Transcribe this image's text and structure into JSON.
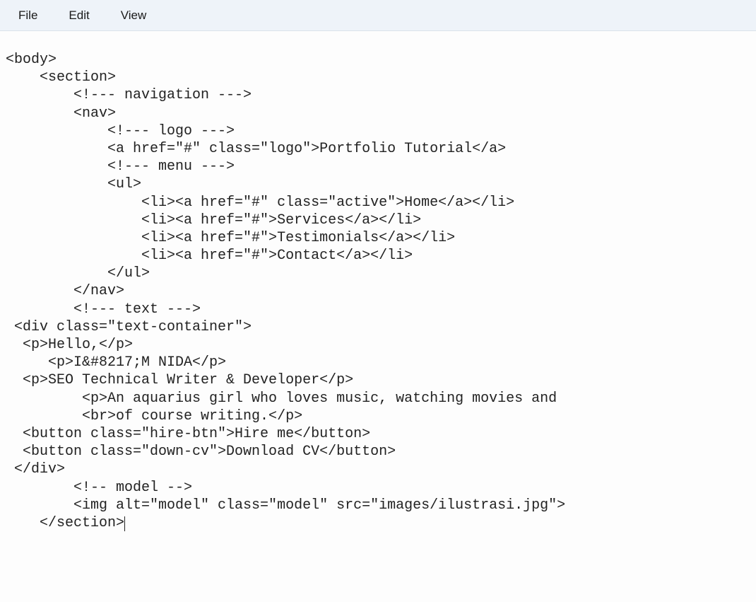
{
  "menubar": {
    "items": [
      "File",
      "Edit",
      "View"
    ]
  },
  "code": {
    "lines": [
      "<body>",
      "    <section>",
      "        <!--- navigation --->",
      "        <nav>",
      "            <!--- logo --->",
      "            <a href=\"#\" class=\"logo\">Portfolio Tutorial</a>",
      "            <!--- menu --->",
      "            <ul>",
      "                <li><a href=\"#\" class=\"active\">Home</a></li>",
      "                <li><a href=\"#\">Services</a></li>",
      "                <li><a href=\"#\">Testimonials</a></li>",
      "                <li><a href=\"#\">Contact</a></li>",
      "            </ul>",
      "        </nav>",
      "",
      "        <!--- text --->",
      " <div class=\"text-container\">",
      "  <p>Hello,</p>",
      "     <p>I&#8217;M NIDA</p>",
      "  <p>SEO Technical Writer & Developer</p>",
      "         <p>An aquarius girl who loves music, watching movies and",
      "         <br>of course writing.</p>",
      "  <button class=\"hire-btn\">Hire me</button>",
      "  <button class=\"down-cv\">Download CV</button>",
      " </div>",
      "        <!-- model -->",
      "        <img alt=\"model\" class=\"model\" src=\"images/ilustrasi.jpg\">",
      "    </section>"
    ],
    "caret_after_line_index": 27
  }
}
